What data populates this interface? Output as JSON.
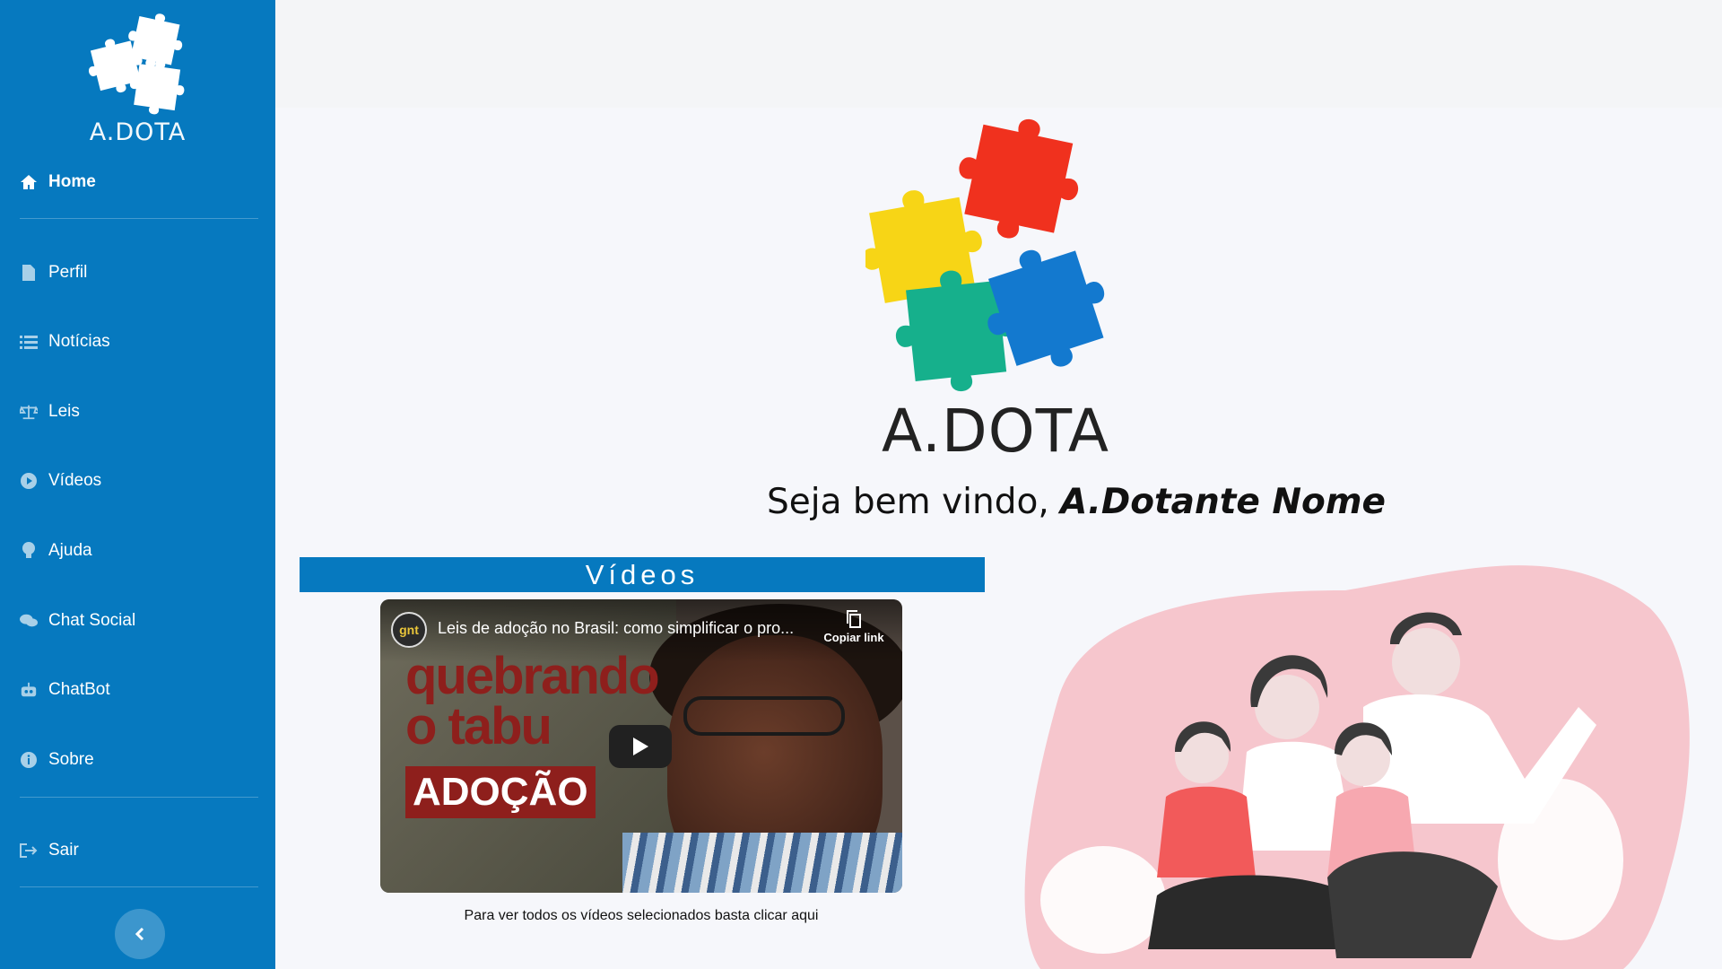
{
  "sidebar": {
    "brand": "A.DOTA",
    "items": [
      {
        "label": "Home",
        "icon": "home-icon",
        "active": true
      },
      {
        "label": "Perfil",
        "icon": "file-icon"
      },
      {
        "label": "Notícias",
        "icon": "list-icon"
      },
      {
        "label": "Leis",
        "icon": "scale-icon"
      },
      {
        "label": "Vídeos",
        "icon": "play-circle-icon"
      },
      {
        "label": "Ajuda",
        "icon": "lightbulb-icon"
      },
      {
        "label": "Chat Social",
        "icon": "comments-icon"
      },
      {
        "label": "ChatBot",
        "icon": "robot-icon"
      },
      {
        "label": "Sobre",
        "icon": "info-icon"
      },
      {
        "label": "Sair",
        "icon": "sign-out-icon"
      }
    ]
  },
  "hero": {
    "title": "A.DOTA",
    "welcome_prefix": "Seja bem vindo, ",
    "welcome_name": "A.Dotante Nome"
  },
  "videos": {
    "header": "Vídeos",
    "video_title": "Leis de adoção no Brasil: como simplificar o pro...",
    "channel": "gnt",
    "copy_link": "Copiar link",
    "overlay_line1": "quebrando",
    "overlay_line2": "o tabu",
    "overlay_tag": "ADOÇÃO",
    "caption": "Para ver todos os vídeos selecionados basta clicar aqui"
  },
  "colors": {
    "sidebar": "#0679bf",
    "puzzle_red": "#f0311e",
    "puzzle_yellow": "#f7d516",
    "puzzle_green": "#16b08c",
    "puzzle_blue": "#1379cf",
    "family_bg": "#f6c6cd"
  }
}
